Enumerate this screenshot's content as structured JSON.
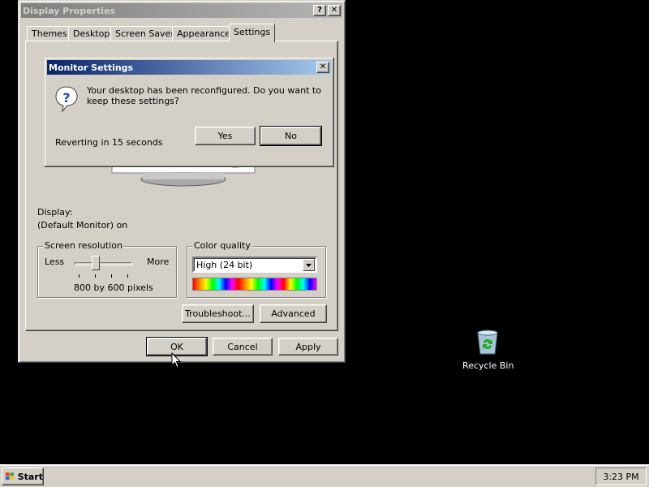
{
  "display_properties": {
    "title": "Display Properties",
    "help_button": "?",
    "close_button": "✕",
    "tabs": [
      {
        "label": "Themes"
      },
      {
        "label": "Desktop"
      },
      {
        "label": "Screen Saver"
      },
      {
        "label": "Appearance"
      },
      {
        "label": "Settings"
      }
    ],
    "selected_tab": "Settings",
    "display_label": "Display:",
    "display_value": "(Default Monitor) on",
    "screen_resolution": {
      "legend": "Screen resolution",
      "less_label": "Less",
      "more_label": "More",
      "value_text": "800 by 600 pixels"
    },
    "color_quality": {
      "legend": "Color quality",
      "selected": "High (24 bit)"
    },
    "troubleshoot_button": "Troubleshoot...",
    "advanced_button": "Advanced",
    "ok_button": "OK",
    "cancel_button": "Cancel",
    "apply_button": "Apply"
  },
  "monitor_dialog": {
    "title": "Monitor Settings",
    "close_button": "✕",
    "message": "Your desktop has been reconfigured.  Do you want to keep these settings?",
    "countdown": "Reverting in 15 seconds",
    "yes_button": "Yes",
    "no_button": "No"
  },
  "desktop": {
    "recycle_bin_label": "Recycle Bin"
  },
  "taskbar": {
    "start_label": "Start",
    "clock": "3:23 PM"
  },
  "colors": {
    "window_face": "#d4d0c8",
    "active_title_start": "#0a246a",
    "active_title_end": "#a6caf0",
    "inactive_title": "#808080",
    "desktop": "#000000"
  }
}
